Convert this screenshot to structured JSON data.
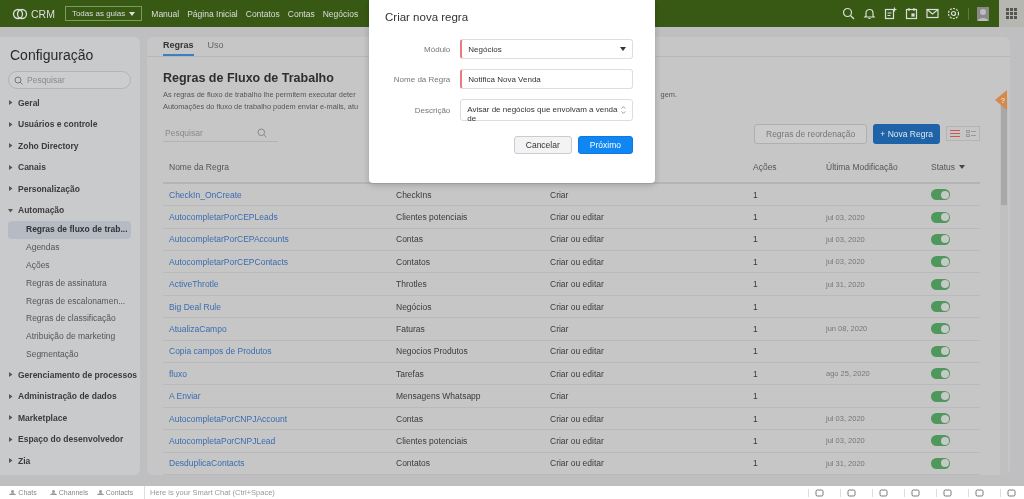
{
  "topbar": {
    "brand": "CRM",
    "tab_menu": "Todas as guias",
    "nav": [
      "Manual",
      "Página Inicial",
      "Contatos",
      "Contas",
      "Negócios"
    ]
  },
  "sidebar": {
    "title": "Configuração",
    "search": {
      "placeholder": "Pesquisar"
    },
    "items": [
      {
        "label": "Geral",
        "expanded": false
      },
      {
        "label": "Usuários e controle",
        "expanded": false
      },
      {
        "label": "Zoho Directory",
        "expanded": false
      },
      {
        "label": "Canais",
        "expanded": false
      },
      {
        "label": "Personalização",
        "expanded": false
      },
      {
        "label": "Automação",
        "expanded": true,
        "children": [
          {
            "label": "Regras de fluxo de trab...",
            "selected": true
          },
          {
            "label": "Agendas",
            "selected": false
          },
          {
            "label": "Ações",
            "selected": false
          },
          {
            "label": "Regras de assinatura",
            "selected": false
          },
          {
            "label": "Regras de escalonamen...",
            "selected": false
          },
          {
            "label": "Regras de classificação",
            "selected": false
          },
          {
            "label": "Atribuição de marketing",
            "selected": false
          },
          {
            "label": "Segmentação",
            "selected": false
          }
        ]
      },
      {
        "label": "Gerenciamento de processos",
        "expanded": false
      },
      {
        "label": "Administração de dados",
        "expanded": false
      },
      {
        "label": "Marketplace",
        "expanded": false
      },
      {
        "label": "Espaço do desenvolvedor",
        "expanded": false
      },
      {
        "label": "Zia",
        "expanded": false
      }
    ]
  },
  "tabs": [
    {
      "label": "Regras",
      "selected": true
    },
    {
      "label": "Uso",
      "selected": false
    }
  ],
  "heading": "Regras de Fluxo de Trabalho",
  "description": [
    {
      "left": "As regras de fluxo de trabalho lhe permitem executar deter",
      "right": "gem."
    },
    {
      "left": "Automações do fluxo de trabalho podem enviar e-mails, atu"
    }
  ],
  "search": {
    "placeholder": "Pesquisar"
  },
  "buttons": {
    "reorder": "Regras de reordenação",
    "new": "Nova Regra",
    "new_icon": "+"
  },
  "views": [
    {
      "kind": "list",
      "selected": true
    },
    {
      "kind": "card",
      "selected": false
    }
  ],
  "table": {
    "columns": [
      "Nome da Regra",
      "Ações",
      "Última Modificação",
      "Status"
    ],
    "rows": [
      {
        "name": "CheckIn_OnCreate",
        "module": "CheckIns",
        "trigger": "Criar",
        "actions": "1",
        "on": true
      },
      {
        "name": "AutocompletarPorCEPLeads",
        "module": "Clientes potenciais",
        "trigger": "Criar ou editar",
        "actions": "1",
        "modified": "jul 03, 2020",
        "on": true
      },
      {
        "name": "AutocompletarPorCEPAccounts",
        "module": "Contas",
        "trigger": "Criar ou editar",
        "actions": "1",
        "modified": "jul 03, 2020",
        "on": true
      },
      {
        "name": "AutocompletarPorCEPContacts",
        "module": "Contatos",
        "trigger": "Criar ou editar",
        "actions": "1",
        "modified": "jul 03, 2020",
        "on": true
      },
      {
        "name": "ActiveThrotle",
        "module": "Throtles",
        "trigger": "Criar ou editar",
        "actions": "1",
        "modified": "jul 31, 2020",
        "on": true
      },
      {
        "name": "Big Deal Rule",
        "module": "Negócios",
        "trigger": "Criar ou editar",
        "actions": "1",
        "on": true
      },
      {
        "name": "AtualizaCampo",
        "module": "Faturas",
        "trigger": "Criar",
        "actions": "1",
        "modified": "jun 08, 2020",
        "on": true
      },
      {
        "name": "Copia campos de Produtos",
        "module": "Negocios Produtos",
        "trigger": "Criar ou editar",
        "actions": "1",
        "on": true
      },
      {
        "name": "fluxo",
        "module": "Tarefas",
        "trigger": "Criar ou editar",
        "actions": "1",
        "modified": "ago 25, 2020",
        "on": true
      },
      {
        "name": "A Enviar",
        "module": "Mensagens Whatsapp",
        "trigger": "Criar",
        "actions": "1",
        "on": true
      },
      {
        "name": "AutocompletaPorCNPJAccount",
        "module": "Contas",
        "trigger": "Criar ou editar",
        "actions": "1",
        "modified": "jul 03, 2020",
        "on": true
      },
      {
        "name": "AutocompletaPorCNPJLead",
        "module": "Clientes potenciais",
        "trigger": "Criar ou editar",
        "actions": "1",
        "modified": "jul 03, 2020",
        "on": true
      },
      {
        "name": "DesduplicaContacts",
        "module": "Contatos",
        "trigger": "Criar ou editar",
        "actions": "1",
        "modified": "jul 31, 2020",
        "on": true
      }
    ]
  },
  "help": "?",
  "dialog": {
    "title": "Criar nova regra",
    "fields": [
      {
        "label": "Módulo",
        "kind": "select",
        "value": "Negócios",
        "required": true
      },
      {
        "label": "Nome da Regra",
        "kind": "text",
        "value": "Notifica Nova Venda",
        "required": true
      },
      {
        "label": "Descrição",
        "kind": "textarea",
        "value": "Avisar de negócios que envolvam a venda de",
        "required": false
      }
    ],
    "cancel": "Cancelar",
    "next": "Próximo"
  },
  "bottombar": {
    "apps": [
      "Chats",
      "Channels",
      "Contacts"
    ],
    "chat_placeholder": "Here is your Smart Chat (Ctrl+Space)"
  }
}
